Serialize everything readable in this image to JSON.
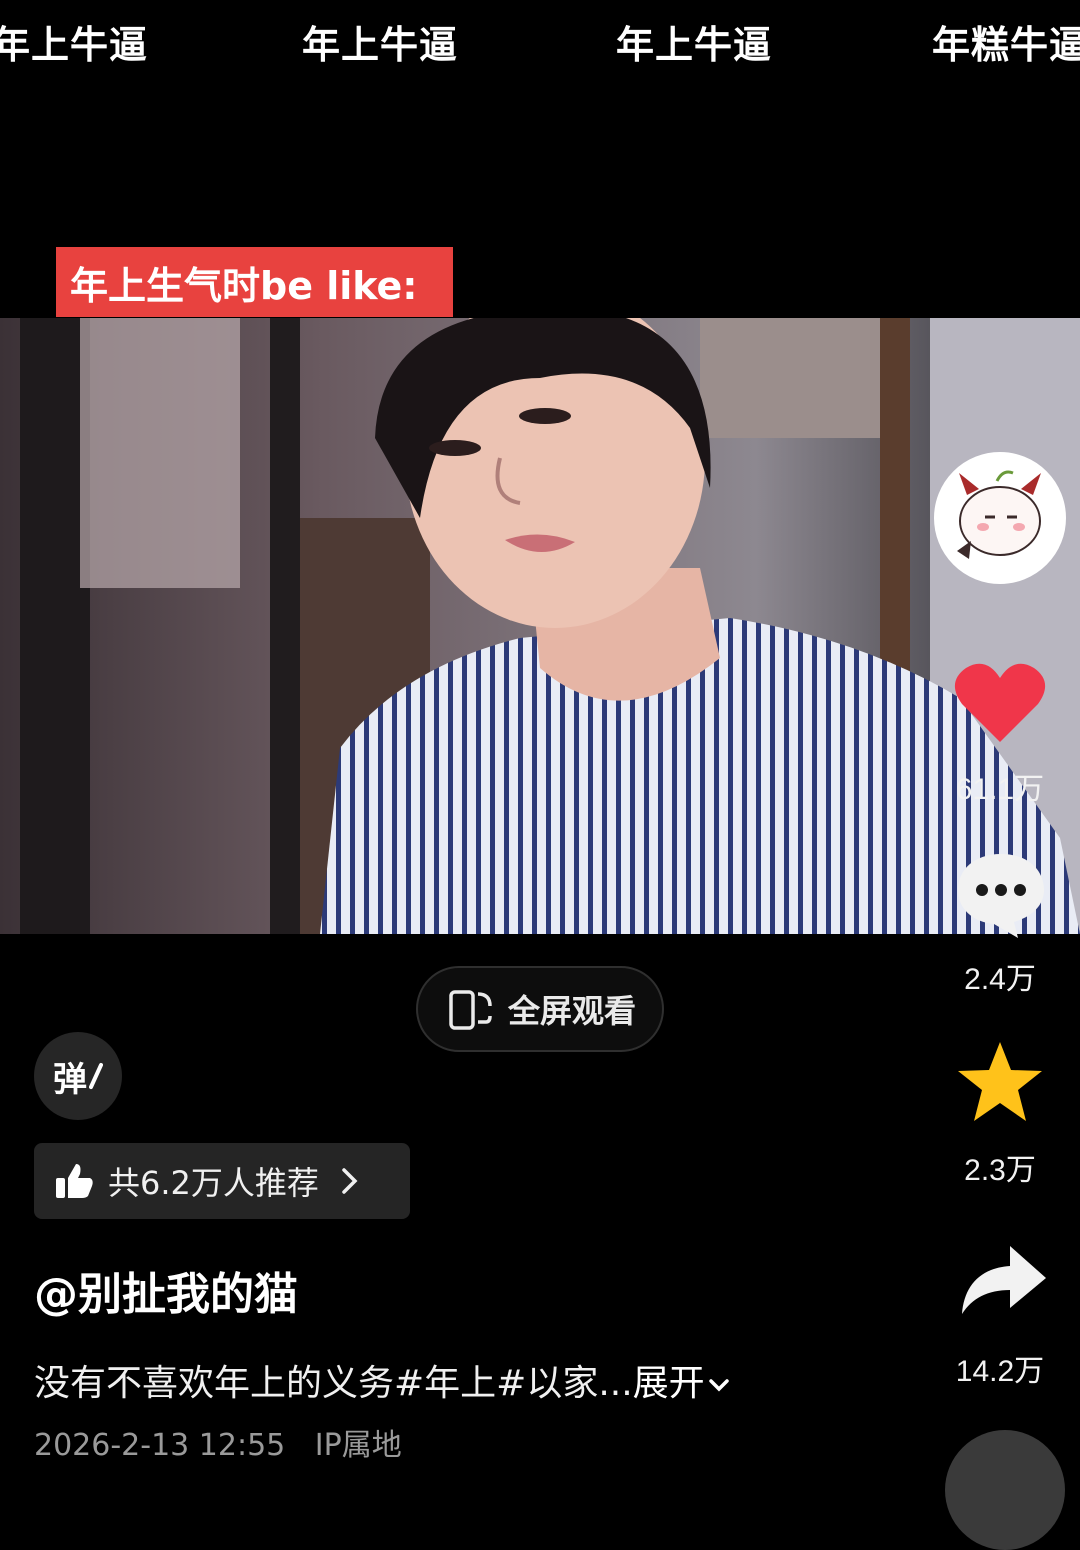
{
  "danmaku": [
    "年上牛逼",
    "年上牛逼",
    "年上牛逼",
    "年糕牛逼"
  ],
  "video": {
    "title_tag": "年上生气时be like:"
  },
  "actions": {
    "like_count": "61.1万",
    "comment_count": "2.4万",
    "favorite_count": "2.3万",
    "share_count": "14.2万"
  },
  "fullscreen": {
    "label": "全屏观看"
  },
  "danmu_toggle": {
    "label": "弹"
  },
  "recommend": {
    "label": "共6.2万人推荐"
  },
  "post": {
    "author": "@别扯我的猫",
    "description": "没有不喜欢年上的义务#年上#以家...",
    "expand_label": "展开",
    "timestamp": "2026-2-13 12:55",
    "ip_label": "IP属地"
  },
  "colors": {
    "accent_red": "#e8423f",
    "like_red": "#f0364a",
    "favorite_yellow": "#ffc21a"
  },
  "icons": [
    "heart-icon",
    "comment-icon",
    "star-icon",
    "share-icon",
    "fullscreen-icon",
    "thumbs-up-icon",
    "chevron-right-icon",
    "chevron-down-icon"
  ]
}
